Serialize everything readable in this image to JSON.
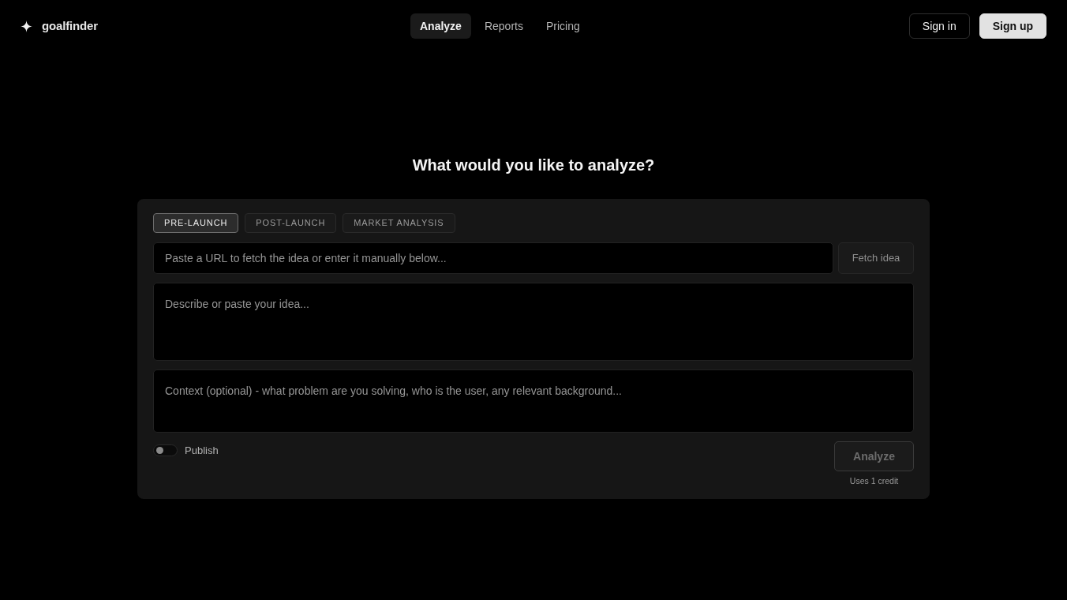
{
  "brand": {
    "name": "goalfinder"
  },
  "nav": [
    {
      "label": "Analyze",
      "selected": true
    },
    {
      "label": "Reports",
      "selected": false
    },
    {
      "label": "Pricing",
      "selected": false
    }
  ],
  "auth": {
    "sign_in": "Sign in",
    "sign_up": "Sign up"
  },
  "heading": "What would you like to analyze?",
  "tabs": [
    {
      "label": "PRE-LAUNCH",
      "selected": true
    },
    {
      "label": "POST-LAUNCH",
      "selected": false
    },
    {
      "label": "MARKET ANALYSIS",
      "selected": false
    }
  ],
  "url_field": {
    "placeholder": "Paste a URL to fetch the idea or enter it manually below..."
  },
  "fetch_button": {
    "label": "Fetch idea"
  },
  "idea_field": {
    "placeholder": "Describe or paste your idea..."
  },
  "context_field": {
    "placeholder": "Context (optional) - what problem are you solving, who is the user, any relevant background..."
  },
  "publish": {
    "label": "Publish",
    "on": false
  },
  "analyze_button": {
    "label": "Analyze",
    "disabled": true
  },
  "credit_note": "Uses 1 credit"
}
